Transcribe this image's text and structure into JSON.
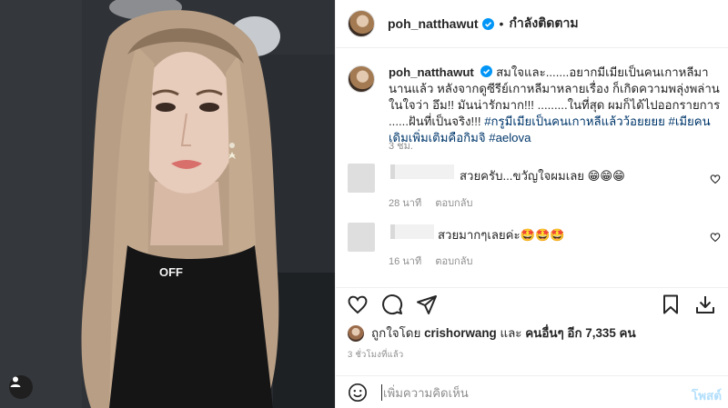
{
  "post": {
    "username": "poh_natthawut",
    "follow_status": "กำลังติดตาม",
    "caption_user": "poh_natthawut",
    "caption_body": "สมใจและ.......อยากมีเมียเป็นคนเกาหลีมานานแล้ว หลังจากดูซีรีย์เกาหลีมาหลายเรื่อง ก็เกิดความพลุ่งพล่านในใจว่า อึม!! มันน่ารักมาก!!! .........ในที่สุด ผมก็ได้ไปออกรายการ ......ฝันที่เป็นจริง!!! ",
    "hashtags": "#กรูมีเมียเป็นคนเกาหลีแล้วว้อยยยย #เมียคนเดิมเพิ่มเติมคือกิมจิ #aelova",
    "caption_time": "3 ชม."
  },
  "photo": {
    "shirt_text": "OFF"
  },
  "comments": [
    {
      "text": "สวยครับ...ขวัญใจผมเลย 😁😁😁",
      "time": "28 นาที",
      "reply": "ตอบกลับ"
    },
    {
      "text": "สวยมากๆเลยค่ะ🤩🤩🤩",
      "time": "16 นาที",
      "reply": "ตอบกลับ"
    }
  ],
  "likes": {
    "prefix": "ถูกใจโดย",
    "by": "crishorwang",
    "and": "และ",
    "others": "คนอื่นๆ อีก 7,335 คน"
  },
  "timestamp": "3 ชั่วโมงที่แล้ว",
  "add_comment": {
    "placeholder": "เพิ่มความคิดเห็น",
    "post_label": "โพสต์"
  },
  "colors": {
    "verified": "#0095f6",
    "hashtag": "#00376b",
    "post_disabled": "#b2dffc"
  },
  "icons": [
    "heart-icon",
    "comment-icon",
    "share-icon",
    "bookmark-icon",
    "download-icon",
    "emoji-icon",
    "user-tag-icon",
    "verified-icon"
  ]
}
